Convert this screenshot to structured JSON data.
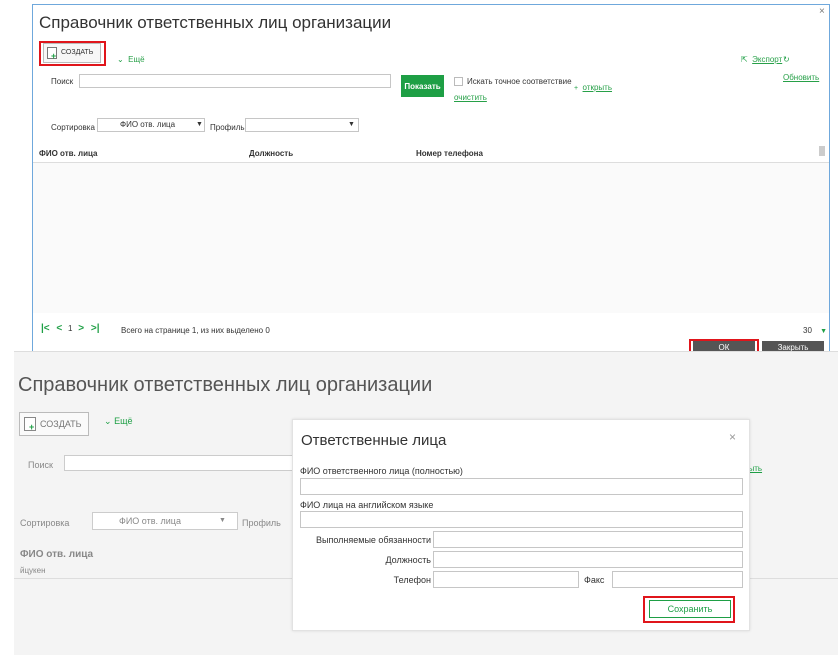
{
  "top": {
    "title": "Справочник ответственных лиц организации",
    "create_label": "СОЗДАТЬ",
    "more_label": "Ещё",
    "export_label": "Экспорт",
    "refresh_label": "Обновить",
    "search_label": "Поиск",
    "search_value": "",
    "show_button": "Показать",
    "exact_match_label": "Искать точное соответствие",
    "open_link": "открыть",
    "clear_link": "очистить",
    "sort_label": "Сортировка",
    "sort_value": "ФИО отв. лица",
    "profile_label": "Профиль",
    "profile_value": "",
    "columns": [
      "ФИО отв. лица",
      "Должность",
      "Номер телефона"
    ],
    "pager_current": "1",
    "pager_summary": "Всего на странице 1, из них выделено 0",
    "page_size": "30",
    "ok_label": "ОК",
    "close_label": "Закрыть"
  },
  "bottom": {
    "title": "Справочник ответственных лиц организации",
    "create_label": "СОЗДАТЬ",
    "more_label": "Ещё",
    "search_label": "Поиск",
    "open_link_fragment": "рыть",
    "sort_label": "Сортировка",
    "sort_value": "ФИО отв. лица",
    "profile_label": "Профиль",
    "col_fio": "ФИО отв. лица",
    "row_value": "йцукен"
  },
  "dialog": {
    "title": "Ответственные лица",
    "fio_full_label": "ФИО ответственного лица (полностью)",
    "fio_full_value": "",
    "fio_en_label": "ФИО лица на английском языке",
    "fio_en_value": "",
    "duties_label": "Выполняемые обязанности",
    "duties_value": "",
    "position_label": "Должность",
    "position_value": "",
    "phone_label": "Телефон",
    "phone_value": "",
    "fax_label": "Факс",
    "fax_value": "",
    "save_label": "Сохранить"
  },
  "colors": {
    "accent_green": "#1e9f45",
    "highlight_red": "#e0151b",
    "dark_button": "#555555",
    "frame_blue": "#6fa8dc"
  }
}
